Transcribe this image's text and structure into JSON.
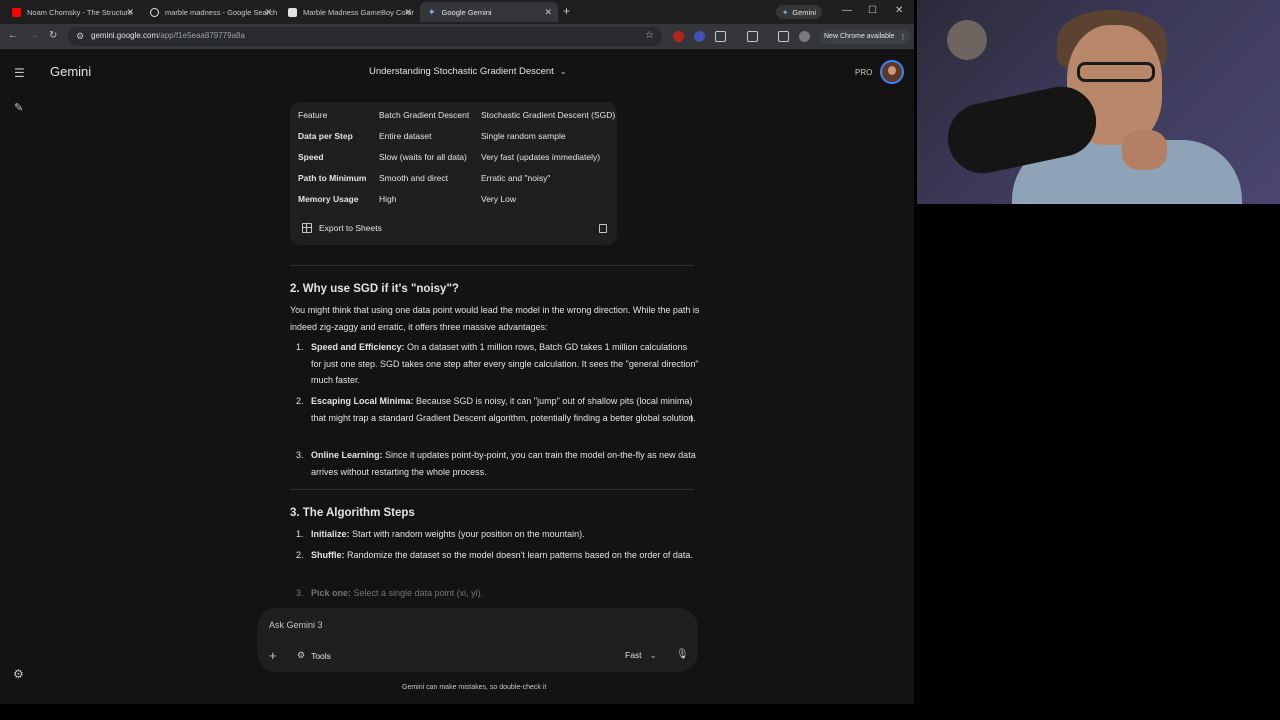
{
  "browser": {
    "tabs": [
      {
        "title": "Noam Chomsky - The Structure",
        "favicon_color": "#ff0000",
        "active": false
      },
      {
        "title": "marble madness - Google Search",
        "favicon_color": "#e3e3e3",
        "active": false
      },
      {
        "title": "Marble Madness GameBoy Color",
        "favicon_color": "#e3e3e3",
        "active": false
      },
      {
        "title": "Google Gemini",
        "favicon_color": "#8ab4f8",
        "active": true
      }
    ],
    "gemini_chip": "Gemini",
    "url_host": "gemini.google.com",
    "url_path": "/app/f1e5eaa879779a8a",
    "update_label": "New Chrome available"
  },
  "app": {
    "name": "Gemini",
    "conversation_title": "Understanding Stochastic Gradient Descent",
    "plan_label": "PRO"
  },
  "table": {
    "headers": [
      "Feature",
      "Batch Gradient Descent",
      "Stochastic Gradient Descent (SGD)"
    ],
    "rows": [
      [
        "Data per Step",
        "Entire dataset",
        "Single random sample"
      ],
      [
        "Speed",
        "Slow (waits for all data)",
        "Very fast (updates immediately)"
      ],
      [
        "Path to Minimum",
        "Smooth and direct",
        "Erratic and \"noisy\""
      ],
      [
        "Memory Usage",
        "High",
        "Very Low"
      ]
    ],
    "export_label": "Export to Sheets"
  },
  "section2": {
    "heading": "2. Why use SGD if it's \"noisy\"?",
    "intro": "You might think that using one data point would lead the model in the wrong direction. While the path is indeed zig-zaggy and erratic, it offers three massive advantages:",
    "items": [
      {
        "num": "1.",
        "bold": "Speed and Efficiency:",
        "text": " On a dataset with 1 million rows, Batch GD takes 1 million calculations for just one step. SGD takes one step after every single calculation. It sees the \"general direction\" much faster."
      },
      {
        "num": "2.",
        "bold": "Escaping Local Minima:",
        "text": " Because SGD is noisy, it can \"jump\" out of shallow pits (local minima) that might trap a standard Gradient Descent algorithm, potentially finding a better global solution."
      },
      {
        "num": "3.",
        "bold": "Online Learning:",
        "text": " Since it updates point-by-point, you can train the model on-the-fly as new data arrives without restarting the whole process."
      }
    ]
  },
  "section3": {
    "heading": "3. The Algorithm Steps",
    "items": [
      {
        "num": "1.",
        "bold": "Initialize:",
        "text": " Start with random weights (your position on the mountain)."
      },
      {
        "num": "2.",
        "bold": "Shuffle:",
        "text": " Randomize the dataset so the model doesn't learn patterns based on the order of data."
      },
      {
        "num": "3.",
        "bold": "Pick one:",
        "text": " Select a single data point (xi, yi)."
      }
    ]
  },
  "input": {
    "placeholder": "Ask Gemini 3",
    "tools_label": "Tools",
    "mode_label": "Fast"
  },
  "disclaimer": "Gemini can make mistakes, so double-check it"
}
